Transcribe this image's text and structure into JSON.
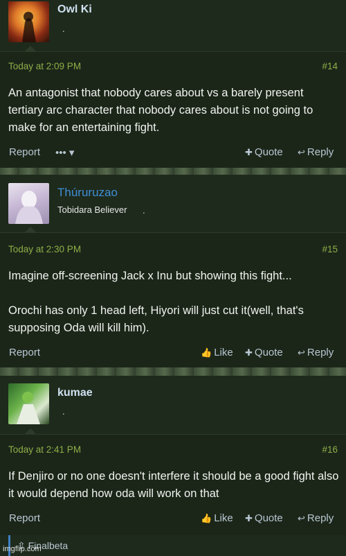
{
  "posts": [
    {
      "username": "Owl Ki",
      "user_title": ".",
      "date": "Today at 2:09 PM",
      "number": "#14",
      "text": "An antagonist that nobody cares about vs a barely present tertiary arc character that nobody cares about is not going to make for an entertaining fight.",
      "actions": {
        "report": "Report",
        "more": "••• ▾",
        "quote": "Quote",
        "reply": "Reply"
      }
    },
    {
      "username": "Thúruruzao",
      "user_title": "Tobidara Believer",
      "user_title_dot": ".",
      "date": "Today at 2:30 PM",
      "number": "#15",
      "text_p1": "Imagine off-screening Jack x Inu but showing this fight...",
      "text_p2": "Orochi has only 1 head left, Hiyori will just cut it(well, that's supposing Oda will kill him).",
      "actions": {
        "report": "Report",
        "like": "Like",
        "quote": "Quote",
        "reply": "Reply"
      }
    },
    {
      "username": "kumae",
      "user_title": ".",
      "date": "Today at 2:41 PM",
      "number": "#16",
      "text": "If Denjiro or no one doesn't interfere it should be a good fight also it would depend how oda will work on that",
      "actions": {
        "report": "Report",
        "like": "Like",
        "quote": "Quote",
        "reply": "Reply"
      }
    }
  ],
  "partial_next": {
    "username": "Finalbeta"
  },
  "watermark": "imgflip.com",
  "colors": {
    "meta": "#8fae47",
    "link": "#3f8fd6",
    "background": "#1b2619"
  }
}
